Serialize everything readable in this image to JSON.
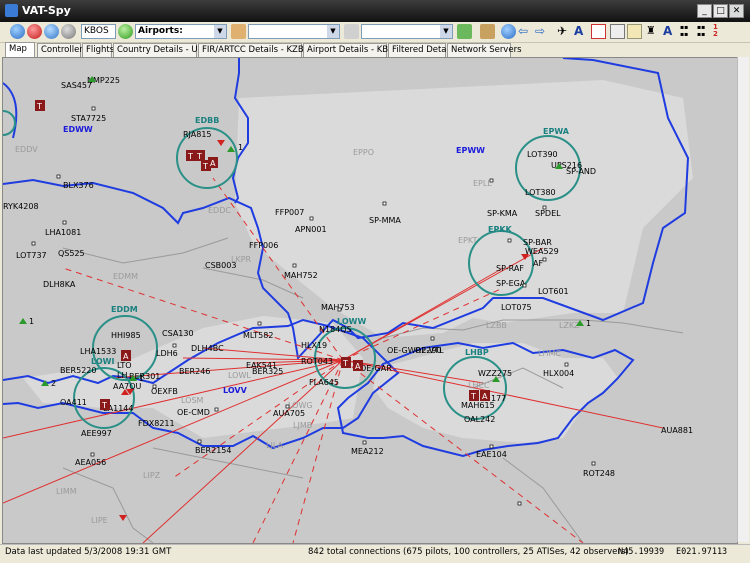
{
  "window": {
    "title": "VAT-Spy",
    "btn_min": "_",
    "btn_max": "□",
    "btn_close": "✕"
  },
  "toolbar": {
    "search_value": "KBOS",
    "airports_label": "Airports:",
    "dropdown2_value": "",
    "dropdown3_value": "",
    "text_a": "A",
    "text_a2": "A",
    "text_a3": "A"
  },
  "tabs": [
    "Map",
    "Controllers",
    "Flights",
    "Country Details - USA",
    "FIR/ARTCC Details - KZBW",
    "Airport Details - KBOS",
    "Filtered Details",
    "Network Servers"
  ],
  "status": {
    "updated": "Data last updated 5/3/2008 19:31 GMT",
    "connections": "842 total connections (675 pilots, 100 controllers, 25 ATISes, 42 observers)",
    "lat": "N45.19939",
    "lon": "E021.97113"
  },
  "map": {
    "firs_blue": [
      "EDWW",
      "EPWW",
      "LOVV"
    ],
    "firs_teal": [
      "EDBB",
      "EPWA",
      "EPKK",
      "EDDM",
      "LOWW",
      "LHBP",
      "LOWI"
    ],
    "firs_gray": [
      "EDDV",
      "EPPO",
      "EPLL",
      "EDDC",
      "LKPR",
      "EPKT",
      "EDMM",
      "LZBB",
      "LZKZ",
      "LHMC",
      "LOWL",
      "LOWG",
      "LJLA",
      "LIMM",
      "LIPE",
      "LHCC",
      "LJMB",
      "LOSM",
      "LIPZ"
    ],
    "callsigns": [
      "NMP225",
      "SAS457",
      "STA7725",
      "BLX376",
      "RYK4208",
      "RJA815",
      "LHA1081",
      "LOT737",
      "QS525",
      "DLH8KA",
      "FFP007",
      "APN001",
      "FFP006",
      "CSB003",
      "MAH752",
      "MAH753",
      "SP-MMA",
      "SP-KMA",
      "SPDEL",
      "SP-BAR",
      "WEA529",
      "SP-RAF",
      "SP-EGA",
      "LOT601",
      "LOT390",
      "UPS216",
      "SP-AND",
      "LOT380",
      "HHI985",
      "LHA1533",
      "DLH6LC",
      "DLH4BC",
      "CSA130",
      "MLT582",
      "N184QS",
      "HLX19",
      "LOW2",
      "BER5220",
      "OA411",
      "BER301",
      "BER246",
      "EAK541",
      "BER325",
      "ROT043",
      "FLA645",
      "LW17",
      "AEE997",
      "AEA056",
      "FDX8211",
      "OE-CMD",
      "AUA705",
      "BER2154",
      "MEA212",
      "OE-VTL",
      "WZZ275",
      "HLX004",
      "MAH615",
      "OAL242",
      "AUA881",
      "ROT248",
      "EAE104",
      "LH442",
      "VTL",
      "OE-GAR",
      "AFT4",
      "MAH177",
      "OE-GWR"
    ]
  }
}
